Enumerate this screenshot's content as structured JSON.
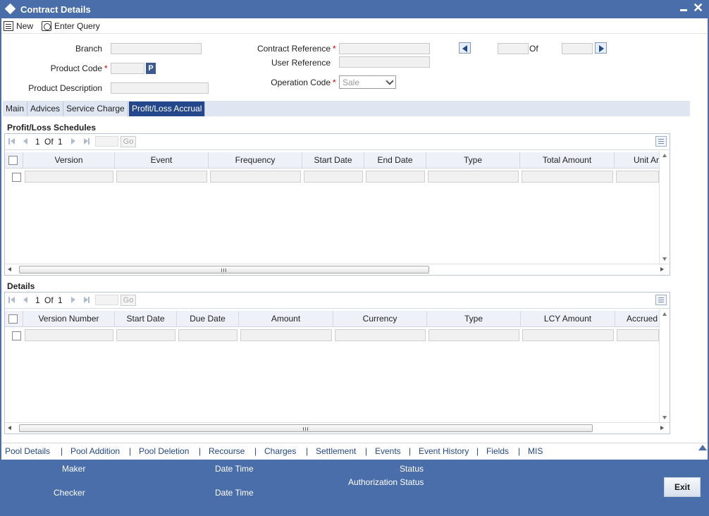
{
  "window": {
    "title": "Contract Details",
    "icon": "diamond-icon",
    "minimize_icon": "minimize-icon",
    "close_glyph": "✕"
  },
  "toolbar": {
    "new_label": "New",
    "enter_query_label": "Enter Query"
  },
  "form": {
    "branch_label": "Branch",
    "product_code_label": "Product Code",
    "product_description_label": "Product Description",
    "contract_reference_label": "Contract Reference",
    "user_reference_label": "User Reference",
    "operation_code_label": "Operation Code",
    "operation_code_value": "Sale",
    "required_marker": "*",
    "p_button": "P",
    "of_label": "Of"
  },
  "tabs": [
    {
      "label": "Main",
      "active": false
    },
    {
      "label": "Advices",
      "active": false
    },
    {
      "label": "Service Charge",
      "active": false
    },
    {
      "label": "Profit/Loss Accrual",
      "active": true
    }
  ],
  "schedules": {
    "title": "Profit/Loss Schedules",
    "page": "1",
    "of": "Of",
    "total": "1",
    "go": "Go",
    "columns": [
      "Version",
      "Event",
      "Frequency",
      "Start Date",
      "End Date",
      "Type",
      "Total Amount",
      "Unit Amount"
    ]
  },
  "details": {
    "title": "Details",
    "page": "1",
    "of": "Of",
    "total": "1",
    "go": "Go",
    "columns": [
      "Version Number",
      "Start Date",
      "Due Date",
      "Amount",
      "Currency",
      "Type",
      "LCY Amount",
      "Accrued"
    ]
  },
  "bottom_links": [
    "Pool Details",
    "Pool Addition",
    "Pool Deletion",
    "Recourse",
    "Charges",
    "Settlement",
    "Events",
    "Event History",
    "Fields",
    "MIS"
  ],
  "link_separator": "|",
  "footer": {
    "maker": "Maker",
    "checker": "Checker",
    "date_time_1": "Date Time",
    "date_time_2": "Date Time",
    "status": "Status",
    "authorization_status": "Authorization Status",
    "exit": "Exit"
  },
  "colors": {
    "header_blue": "#4a6ea9",
    "active_tab": "#24478c",
    "required": "#cc0000"
  }
}
